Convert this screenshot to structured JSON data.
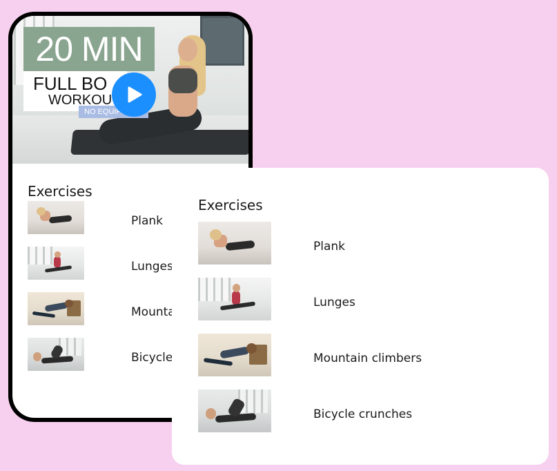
{
  "video": {
    "duration_text": "20 MIN",
    "title_line1": "FULL BO",
    "title_line2": "WORKOU",
    "tag": "NO EQUIPMENT",
    "play_icon": "play-icon"
  },
  "exercises_title": "Exercises",
  "phone_exercises": [
    {
      "label": "Plank",
      "thumb": "plank"
    },
    {
      "label": "Lunges",
      "thumb": "lunges"
    },
    {
      "label": "Mountain",
      "thumb": "mountain"
    },
    {
      "label": "Bicycle cr",
      "thumb": "bicycle"
    }
  ],
  "card_exercises": [
    {
      "label": "Plank",
      "thumb": "plank"
    },
    {
      "label": "Lunges",
      "thumb": "lunges"
    },
    {
      "label": "Mountain climbers",
      "thumb": "mountain"
    },
    {
      "label": "Bicycle crunches",
      "thumb": "bicycle"
    }
  ],
  "colors": {
    "background": "#f8d0ef",
    "play_button": "#1c8fff",
    "duration_box": "#8aa58f",
    "tag": "#a9bce4"
  }
}
